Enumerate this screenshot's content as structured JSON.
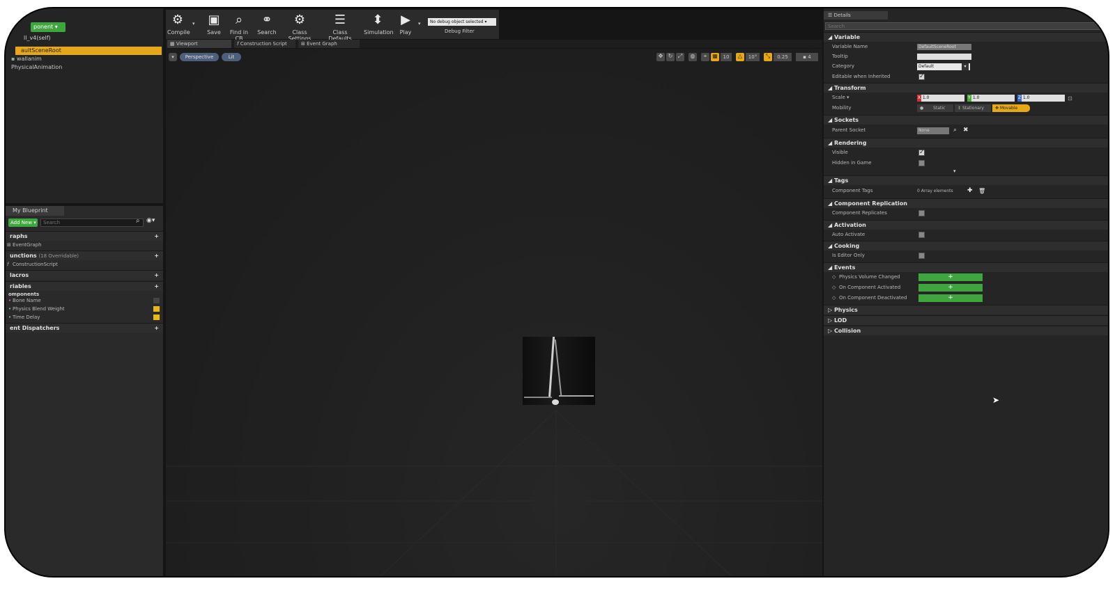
{
  "left": {
    "add_component": "ponent ▾",
    "self_item": "ll_v4(self)",
    "tree": [
      "aultSceneRoot",
      "wallanim",
      "PhysicalAnimation"
    ],
    "blueprint_tab": "My Blueprint",
    "add_new": "Add New ▾",
    "search_placeholder": "Search",
    "cats": {
      "graphs": "raphs",
      "event_graph": "EventGraph",
      "functions": "unctions",
      "functions_count": "(18 Overridable)",
      "construction": "ConstructionScript",
      "macros": "lacros",
      "variables": "riables",
      "components": "omponents",
      "vars": [
        "Bone Name",
        "Physics Blend Weight",
        "Time Delay"
      ],
      "dispatchers": "ent Dispatchers"
    }
  },
  "toolbar": {
    "buttons": [
      "Compile",
      "Save",
      "Find in CB",
      "Search",
      "Class Settings",
      "Class Defaults",
      "Simulation",
      "Play"
    ],
    "debug_select": "No debug object selected ▾",
    "debug_filter": "Debug Filter"
  },
  "tabs": [
    "Viewport",
    "Construction Script",
    "Event Graph"
  ],
  "viewport": {
    "perspective": "Perspective",
    "lit": "Lit",
    "snap_values": [
      "10",
      "10°",
      "0.25",
      "4"
    ]
  },
  "details": {
    "tab": "Details",
    "search_placeholder": "Search",
    "variable": {
      "header": "Variable",
      "name_label": "Variable Name",
      "name_value": "DefaultSceneRoot",
      "tooltip_label": "Tooltip",
      "category_label": "Category",
      "category_value": "Default",
      "editable_label": "Editable when Inherited"
    },
    "transform": {
      "header": "Transform",
      "scale_label": "Scale ▾",
      "x": "1.0",
      "y": "1.0",
      "z": "1.0",
      "mobility_label": "Mobility",
      "static": "Static",
      "stationary": "Stationary",
      "movable": "Movable"
    },
    "sockets": {
      "header": "Sockets",
      "parent_label": "Parent Socket",
      "parent_value": "None"
    },
    "rendering": {
      "header": "Rendering",
      "visible": "Visible",
      "hidden": "Hidden in Game"
    },
    "tags": {
      "header": "Tags",
      "label": "Component Tags",
      "value": "0 Array elements"
    },
    "replication": {
      "header": "Component Replication",
      "label": "Component Replicates"
    },
    "activation": {
      "header": "Activation",
      "label": "Auto Activate"
    },
    "cooking": {
      "header": "Cooking",
      "label": "Is Editor Only"
    },
    "events": {
      "header": "Events",
      "items": [
        "Physics Volume Changed",
        "On Component Activated",
        "On Component Deactivated"
      ]
    },
    "collapsed": [
      "Physics",
      "LOD",
      "Collision"
    ]
  },
  "colors": {
    "accent": "#e6a817",
    "green": "#3fa63f"
  }
}
